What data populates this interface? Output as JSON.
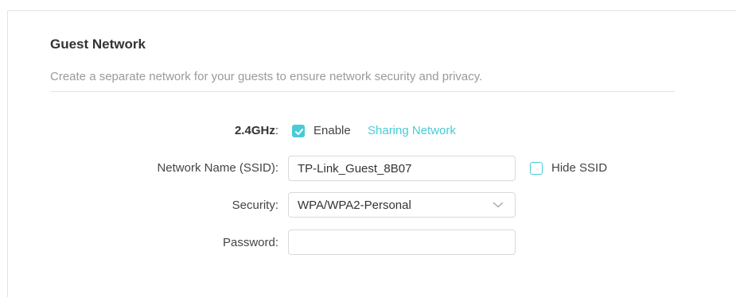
{
  "section": {
    "title": "Guest Network",
    "description": "Create a separate network for your guests to ensure network security and privacy."
  },
  "band": {
    "label": "2.4GHz",
    "label_suffix": ":",
    "enable_label": "Enable",
    "enabled": true,
    "sharing_link": "Sharing Network"
  },
  "ssid": {
    "label": "Network Name (SSID):",
    "value": "TP-Link_Guest_8B07",
    "hide_label": "Hide SSID",
    "hidden": false
  },
  "security": {
    "label": "Security:",
    "selected": "WPA/WPA2-Personal"
  },
  "password": {
    "label": "Password:",
    "value": ""
  },
  "colors": {
    "accent": "#4acbd6",
    "title": "#333333",
    "description": "#9a9a9a"
  }
}
